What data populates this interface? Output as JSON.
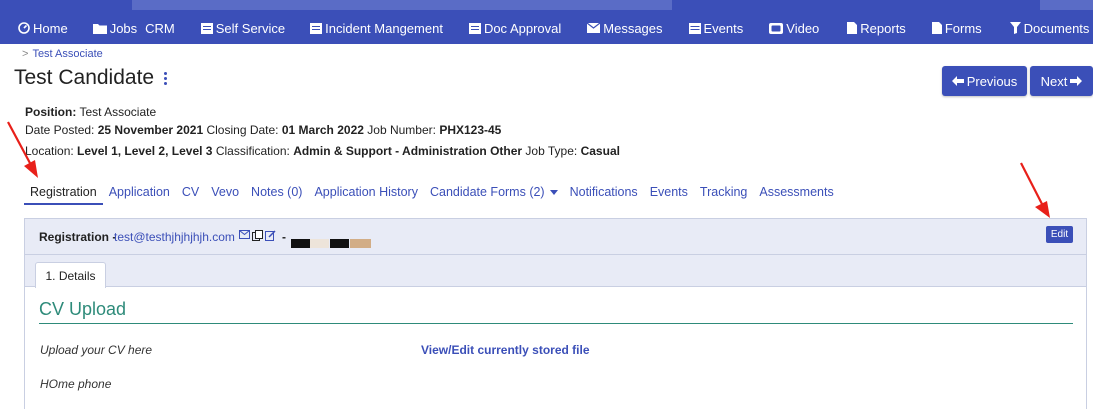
{
  "nav": {
    "items": [
      {
        "label": "Home",
        "icon": "dashboard-icon"
      },
      {
        "label": "Jobs",
        "icon": "folder-icon"
      },
      {
        "label": "CRM",
        "icon": ""
      },
      {
        "label": "Self Service",
        "icon": "list-icon"
      },
      {
        "label": "Incident Mangement",
        "icon": "list-icon"
      },
      {
        "label": "Doc Approval",
        "icon": "list-icon"
      },
      {
        "label": "Messages",
        "icon": "envelope-icon"
      },
      {
        "label": "Events",
        "icon": "calendar-icon"
      },
      {
        "label": "Video",
        "icon": "video-icon"
      },
      {
        "label": "Reports",
        "icon": "file-icon"
      },
      {
        "label": "Forms",
        "icon": "file-icon"
      },
      {
        "label": "Documents",
        "icon": "filter-icon"
      }
    ]
  },
  "breadcrumb": {
    "separator": ">",
    "item": "Test Associate"
  },
  "page": {
    "title": "Test Candidate"
  },
  "buttons": {
    "previous": "Previous",
    "next": "Next",
    "edit": "Edit"
  },
  "info": {
    "position_label": "Position:",
    "position_value": "Test Associate",
    "date_posted_label": "Date Posted:",
    "date_posted_value": "25 November 2021",
    "closing_date_label": "Closing Date:",
    "closing_date_value": "01 March 2022",
    "job_number_label": "Job Number:",
    "job_number_value": "PHX123-45",
    "location_label": "Location:",
    "location_value": "Level 1, Level 2, Level 3",
    "classification_label": "Classification:",
    "classification_value": "Admin & Support - Administration Other",
    "job_type_label": "Job Type:",
    "job_type_value": "Casual"
  },
  "tabs": [
    {
      "label": "Registration"
    },
    {
      "label": "Application"
    },
    {
      "label": "CV"
    },
    {
      "label": "Vevo"
    },
    {
      "label": "Notes (0)"
    },
    {
      "label": "Application History"
    },
    {
      "label": "Candidate Forms (2)"
    },
    {
      "label": "Notifications"
    },
    {
      "label": "Events"
    },
    {
      "label": "Tracking"
    },
    {
      "label": "Assessments"
    }
  ],
  "panel": {
    "label": "Registration -",
    "email": "test@testhjhjhjhjh.com",
    "dash": "-",
    "subtab": "1. Details",
    "section_title": "CV Upload",
    "fields": {
      "upload_label": "Upload your CV here",
      "upload_link": "View/Edit currently stored file",
      "home_phone_label": "HOme phone"
    }
  },
  "colors": {
    "accent": "#3b4fb8",
    "section": "#2e8b7a",
    "annotation": "#e8201a",
    "redaction_dark": "#111111",
    "redaction_tan": "#d2ad86"
  }
}
